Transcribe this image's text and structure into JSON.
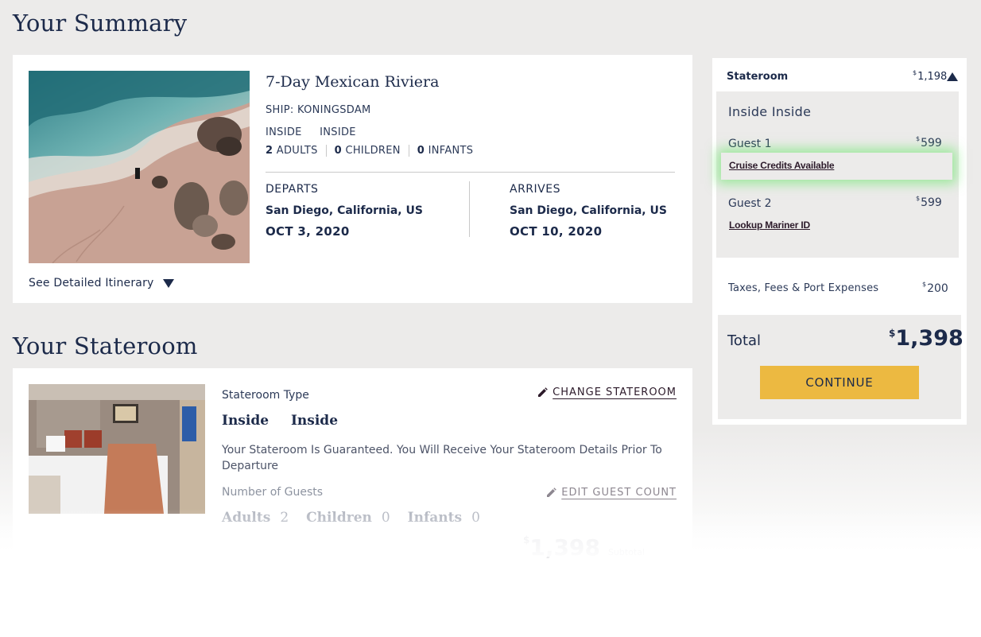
{
  "summary": {
    "heading": "Your Summary",
    "itinerary_title": "7-Day Mexican Riviera",
    "ship": "SHIP: KONINGSDAM",
    "room_types": [
      "INSIDE",
      "INSIDE"
    ],
    "guests": [
      {
        "count": "2",
        "label": "ADULTS"
      },
      {
        "count": "0",
        "label": "CHILDREN"
      },
      {
        "count": "0",
        "label": "INFANTS"
      }
    ],
    "departs": {
      "label": "DEPARTS",
      "port": "San Diego, California, US",
      "date": "OCT 3, 2020"
    },
    "arrives": {
      "label": "ARRIVES",
      "port": "San Diego, California, US",
      "date": "OCT 10, 2020"
    },
    "see_itinerary": "See Detailed Itinerary"
  },
  "stateroom": {
    "heading": "Your Stateroom",
    "type_label": "Stateroom Type",
    "type_names": [
      "Inside",
      "Inside"
    ],
    "change_link": "CHANGE STATEROOM",
    "guarantee_text": "Your Stateroom Is Guaranteed. You Will Receive Your Stateroom Details Prior To Departure",
    "guests_label": "Number of Guests",
    "edit_link": "EDIT GUEST COUNT",
    "counts": [
      {
        "label": "Adults",
        "value": "2"
      },
      {
        "label": "Children",
        "value": "0"
      },
      {
        "label": "Infants",
        "value": "0"
      }
    ],
    "subtotal_currency": "$",
    "subtotal_value": "1,398",
    "subtotal_label": "Subtotal"
  },
  "panel": {
    "header_label": "Stateroom",
    "header_currency": "$",
    "header_price": "1,198",
    "room_title": "Inside Inside",
    "guest1": {
      "label": "Guest 1",
      "currency": "$",
      "price": "599",
      "link": "Cruise Credits Available"
    },
    "guest2": {
      "label": "Guest 2",
      "currency": "$",
      "price": "599",
      "link": "Lookup Mariner ID"
    },
    "taxes_label": "Taxes, Fees & Port Expenses",
    "taxes_currency": "$",
    "taxes_price": "200",
    "total_label": "Total",
    "total_currency": "$",
    "total_price": "1,398",
    "continue_label": "CONTINUE"
  },
  "colors": {
    "navy": "#1c2a4a",
    "page_bg": "#ecebea",
    "continue_btn": "#ecb941",
    "highlight_glow": "#5ae65a"
  },
  "icons": [
    "chevron-down-icon",
    "chevron-up-icon",
    "pencil-icon"
  ]
}
